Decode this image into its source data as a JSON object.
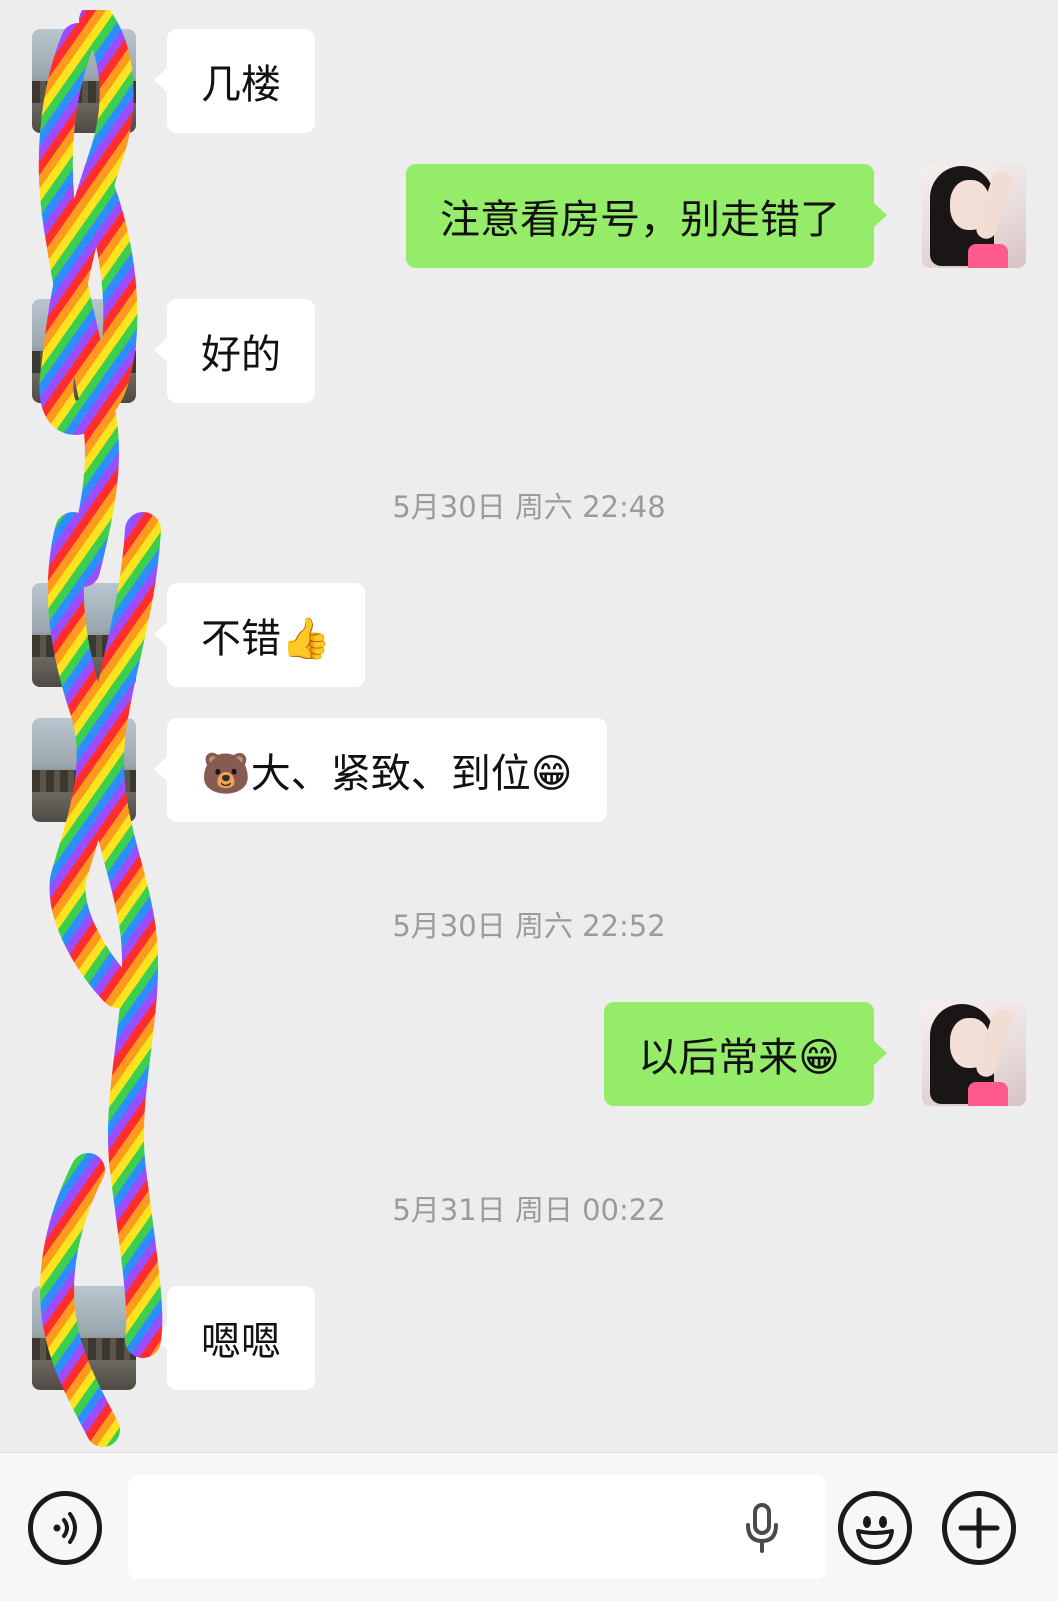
{
  "messages": [
    {
      "side": "left",
      "text": "几楼"
    },
    {
      "side": "right",
      "text": "注意看房号，别走错了"
    },
    {
      "side": "left",
      "text": "好的"
    },
    {
      "side": "left",
      "text": "不错👍"
    },
    {
      "side": "left",
      "text": "🐻大、紧致、到位😁"
    },
    {
      "side": "right",
      "text": "以后常来😁"
    },
    {
      "side": "left",
      "text": "嗯嗯"
    }
  ],
  "timestamps": [
    "5月30日 周六 22:48",
    "5月30日 周六 22:52",
    "5月31日 周日 00:22"
  ],
  "input": {
    "value": "",
    "voice_icon": "voice-toggle-icon",
    "mic_icon": "microphone-icon",
    "emoji_icon": "emoji-icon",
    "plus_icon": "plus-icon"
  },
  "colors": {
    "background": "#ededed",
    "sent_bubble": "#95ec69",
    "received_bubble": "#ffffff",
    "timestamp_text": "#9b9b9b"
  }
}
